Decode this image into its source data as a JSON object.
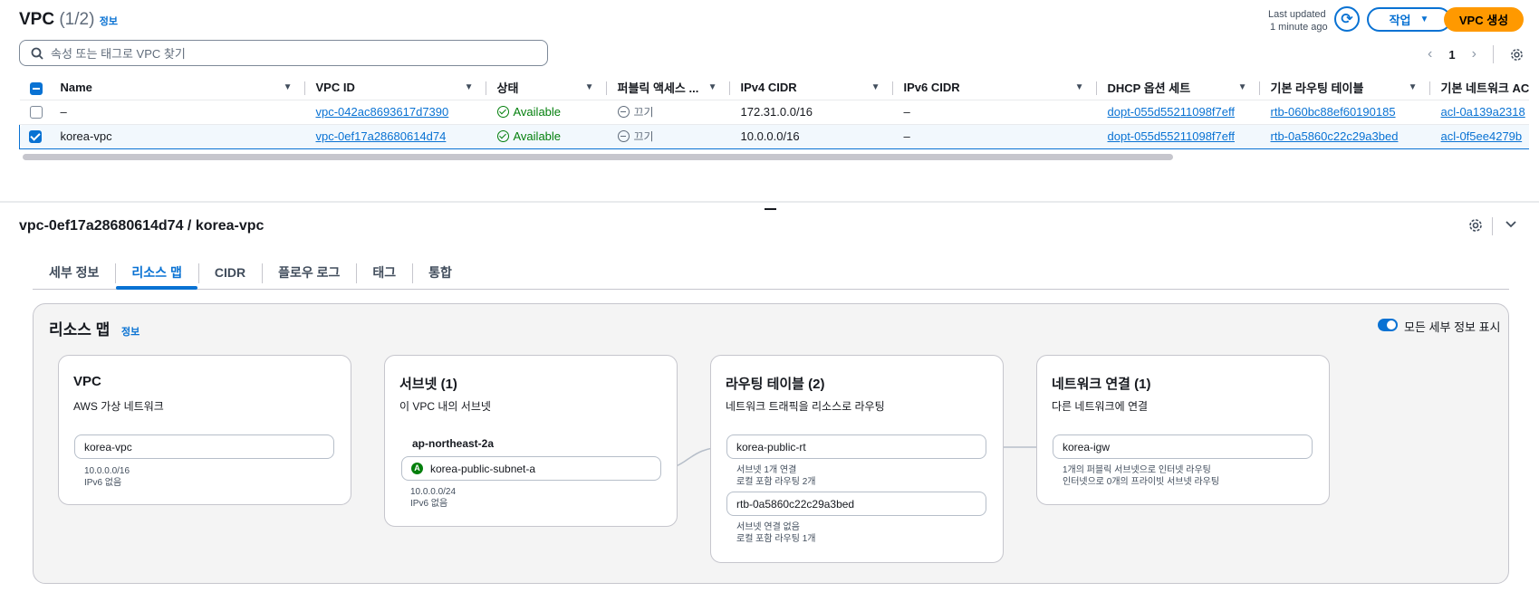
{
  "header": {
    "title": "VPC",
    "count": "(1/2)",
    "info_label": "정보",
    "last_updated_line1": "Last updated",
    "last_updated_line2": "1 minute ago",
    "actions_label": "작업",
    "create_label": "VPC 생성"
  },
  "search": {
    "placeholder": "속성 또는 태그로 VPC 찾기"
  },
  "pagination": {
    "current_page": "1"
  },
  "table": {
    "columns": [
      "Name",
      "VPC ID",
      "상태",
      "퍼블릭 액세스 ...",
      "IPv4 CIDR",
      "IPv6 CIDR",
      "DHCP 옵션 세트",
      "기본 라우팅 테이블",
      "기본 네트워크 AC"
    ],
    "rows": [
      {
        "name": "–",
        "vpc_id": "vpc-042ac8693617d7390",
        "state": "Available",
        "public_access": "끄기",
        "ipv4": "172.31.0.0/16",
        "ipv6": "–",
        "dhcp": "dopt-055d55211098f7eff",
        "route_table": "rtb-060bc88ef60190185",
        "nacl": "acl-0a139a2318"
      },
      {
        "name": "korea-vpc",
        "vpc_id": "vpc-0ef17a28680614d74",
        "state": "Available",
        "public_access": "끄기",
        "ipv4": "10.0.0.0/16",
        "ipv6": "–",
        "dhcp": "dopt-055d55211098f7eff",
        "route_table": "rtb-0a5860c22c29a3bed",
        "nacl": "acl-0f5ee4279b"
      }
    ]
  },
  "detail": {
    "title": "vpc-0ef17a28680614d74 / korea-vpc",
    "tabs": [
      "세부 정보",
      "리소스 맵",
      "CIDR",
      "플로우 로그",
      "태그",
      "통합"
    ],
    "active_tab": "리소스 맵"
  },
  "resource_map": {
    "title": "리소스 맵",
    "info_label": "정보",
    "toggle_label": "모든 세부 정보 표시",
    "vpc_card": {
      "title": "VPC",
      "subtitle": "AWS 가상 네트워크",
      "name": "korea-vpc",
      "line1": "10.0.0.0/16",
      "line2": "IPv6 없음"
    },
    "subnet_card": {
      "title": "서브넷 (1)",
      "subtitle": "이 VPC 내의 서브넷",
      "az": "ap-northeast-2a",
      "subnet_badge": "A",
      "subnet": "korea-public-subnet-a",
      "line1": "10.0.0.0/24",
      "line2": "IPv6 없음"
    },
    "rt_card": {
      "title": "라우팅 테이블 (2)",
      "subtitle": "네트워크 트래픽을 리소스로 라우팅",
      "rt1": "korea-public-rt",
      "rt1_line1": "서브넷 1개 연결",
      "rt1_line2": "로컬 포함 라우팅 2개",
      "rt2": "rtb-0a5860c22c29a3bed",
      "rt2_line1": "서브넷 연결 없음",
      "rt2_line2": "로컬 포함 라우팅 1개"
    },
    "net_card": {
      "title": "네트워크 연결 (1)",
      "subtitle": "다른 네트워크에 연결",
      "igw": "korea-igw",
      "line1": "1개의 퍼블릭 서브넷으로 인터넷 라우팅",
      "line2": "인터넷으로 0개의 프라이빗 서브넷 라우팅"
    }
  },
  "colors": {
    "accent": "#0972d3",
    "primary_button": "#ff9900",
    "available": "#037f0c"
  }
}
